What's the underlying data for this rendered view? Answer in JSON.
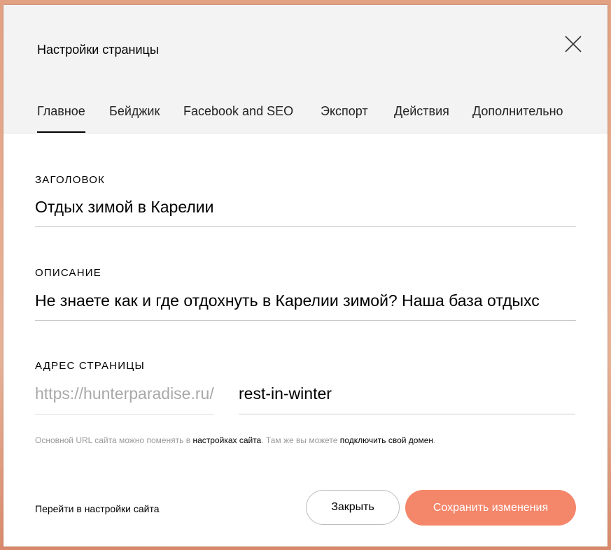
{
  "dialog": {
    "title": "Настройки страницы"
  },
  "tabs": [
    {
      "label": "Главное",
      "active": true
    },
    {
      "label": "Бейджик",
      "active": false
    },
    {
      "label": "Facebook and SEO",
      "active": false
    },
    {
      "label": "Экспорт",
      "active": false
    },
    {
      "label": "Действия",
      "active": false
    },
    {
      "label": "Дополнительно",
      "active": false
    }
  ],
  "fields": {
    "title": {
      "label": "ЗАГОЛОВОК",
      "value": "Отдых зимой в Карелии"
    },
    "description": {
      "label": "ОПИСАНИЕ",
      "value": "Не знаете как и где отдохнуть в Карелии зимой? Наша база отдыхс"
    },
    "address": {
      "label": "АДРЕС СТРАНИЦЫ",
      "prefix": "https://hunterparadise.ru/",
      "slug": "rest-in-winter"
    }
  },
  "hint": {
    "part1": "Основной URL сайта можно поменять в ",
    "link1": "настройках сайта",
    "part2": ". Там же вы можете ",
    "link2": "подключить свой домен",
    "part3": "."
  },
  "footer": {
    "site_settings_link": "Перейти в настройки сайта",
    "close_label": "Закрыть",
    "save_label": "Сохранить изменения"
  },
  "colors": {
    "accent": "#f4866a",
    "header_bg": "#f3f3f3",
    "annotation": "#0a1ee6"
  },
  "icons": {
    "close": "close-icon"
  }
}
